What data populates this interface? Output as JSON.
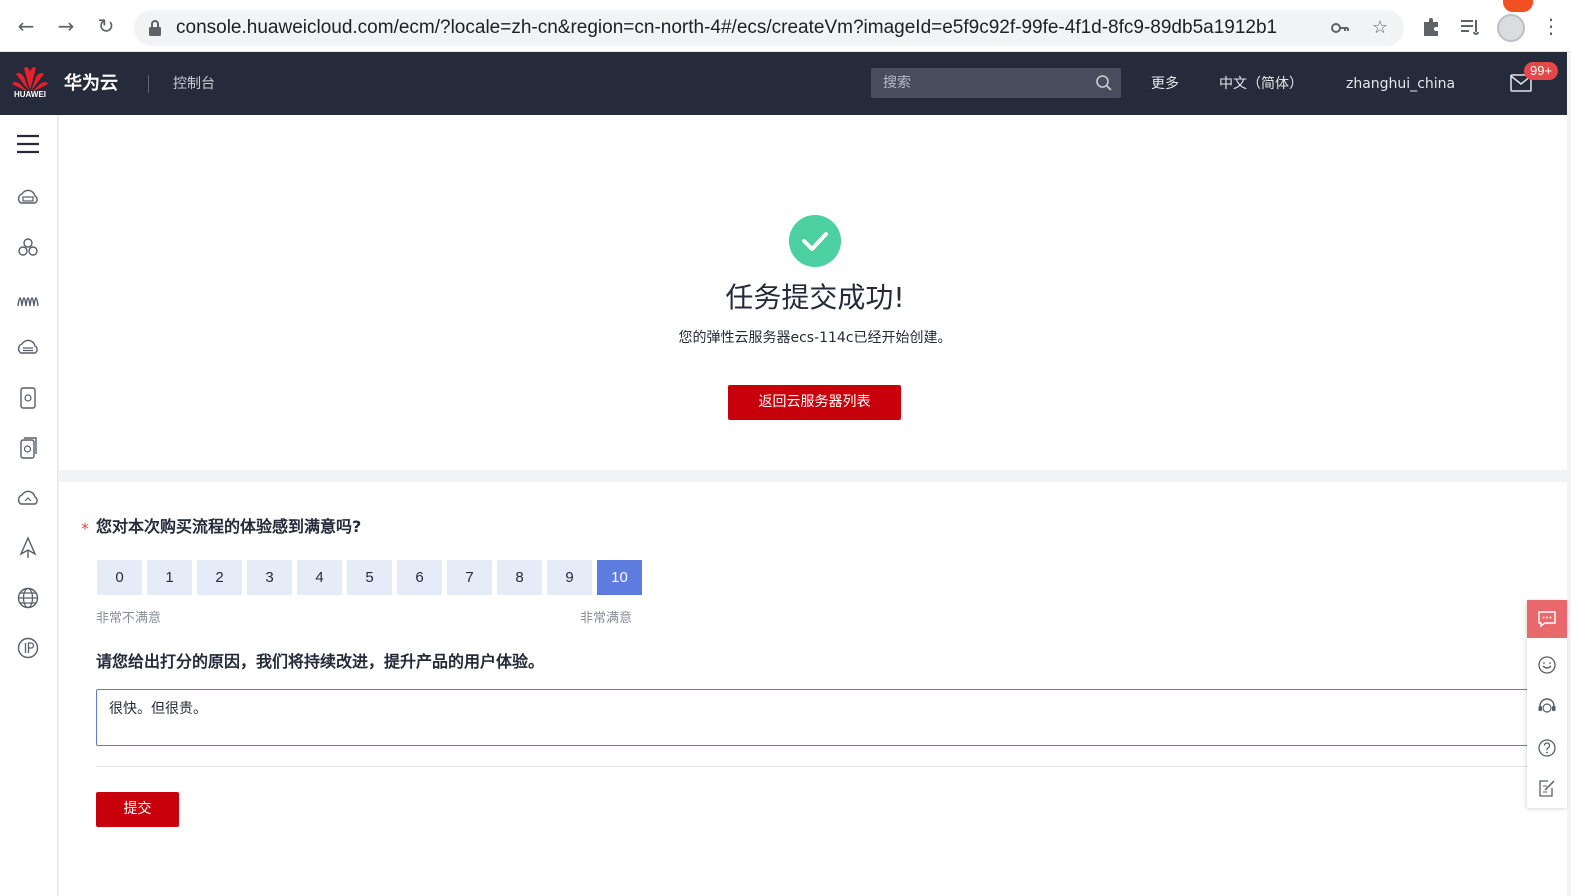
{
  "browser": {
    "url": "console.huaweicloud.com/ecm/?locale=zh-cn&region=cn-north-4#/ecs/createVm?imageId=e5f9c92f-99fe-4f1d-8fc9-89db5a1912b1",
    "icons": [
      "back-icon",
      "forward-icon",
      "reload-icon",
      "lock-icon",
      "key-icon",
      "star-icon",
      "puzzle-icon",
      "reading-list-icon",
      "profile-icon",
      "more-icon"
    ]
  },
  "header": {
    "brand": "华为云",
    "logo_text": "HUAWEI",
    "console": "控制台",
    "search_placeholder": "搜索",
    "more": "更多",
    "language": "中文（简体）",
    "username": "zhanghui_china",
    "mail_badge": "99+"
  },
  "sidebar": {
    "icons": [
      "menu-icon",
      "ecs-icon",
      "cluster-icon",
      "monitor-icon",
      "disk-icon",
      "storage-icon",
      "backup-icon",
      "cloud-icon",
      "deploy-icon",
      "network-icon",
      "ip-icon"
    ]
  },
  "success": {
    "title": "任务提交成功!",
    "description": "您的弹性云服务器ecs-114c已经开始创建。",
    "back_button": "返回云服务器列表",
    "accent": "#4dd0a1"
  },
  "survey": {
    "required_mark": "*",
    "question": "您对本次购买流程的体验感到满意吗?",
    "scores": [
      "0",
      "1",
      "2",
      "3",
      "4",
      "5",
      "6",
      "7",
      "8",
      "9",
      "10"
    ],
    "selected_score": "10",
    "low_label": "非常不满意",
    "high_label": "非常满意",
    "reason_question": "请您给出打分的原因，我们将持续改进，提升产品的用户体验。",
    "reason_value": "很快。但很贵。",
    "submit": "提交"
  },
  "colors": {
    "brand_red": "#c7000b",
    "topbar": "#252b3a",
    "score_selected": "#5e7ce0",
    "score_default": "#e6ebf8"
  },
  "float_toolbar": {
    "icons": [
      "chat-icon",
      "smile-icon",
      "support-icon",
      "help-icon",
      "edit-icon"
    ]
  }
}
